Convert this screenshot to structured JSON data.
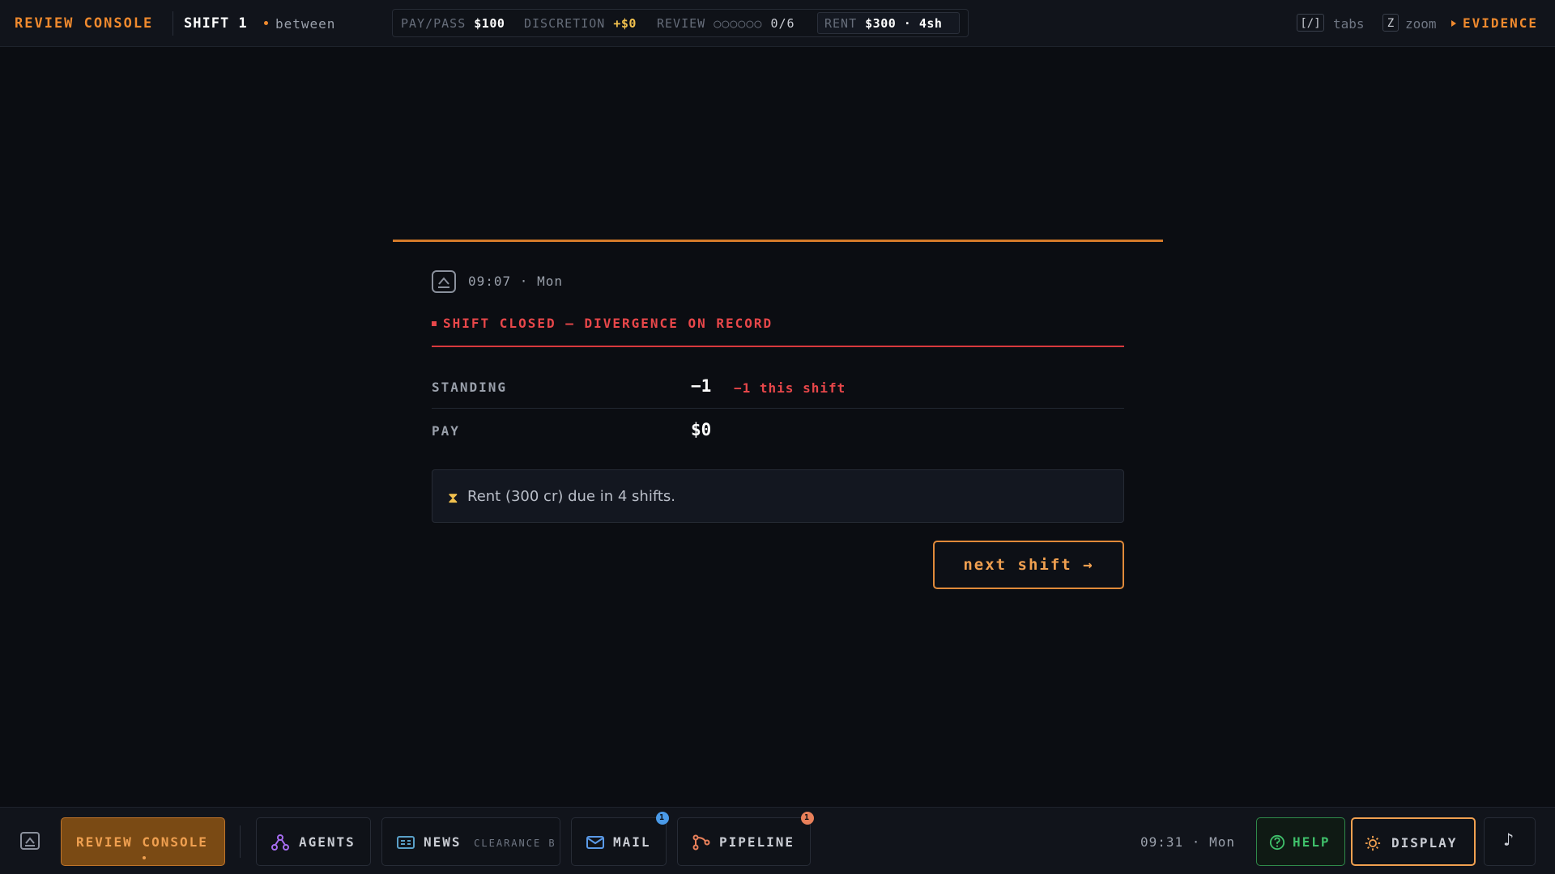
{
  "topbar": {
    "brand": "REVIEW CONSOLE",
    "shift": "SHIFT 1",
    "phase": "between",
    "pay_pass_label": "PAY/PASS",
    "pay_pass_value": "$100",
    "discretion_label": "DISCRETION",
    "discretion_value": "+$0",
    "review_label": "REVIEW",
    "review_dots": "○○○○○○",
    "review_value": "0/6",
    "rent_label": "RENT",
    "rent_value": "$300 · 4sh",
    "tabs_key": "[/]",
    "tabs_label": "tabs",
    "zoom_key": "Z",
    "zoom_label": "zoom",
    "evidence_label": "EVIDENCE"
  },
  "card": {
    "timestamp": "09:07 · Mon",
    "title": "SHIFT CLOSED — DIVERGENCE ON RECORD",
    "standing_label": "STANDING",
    "standing_value": "−1",
    "standing_delta": "−1 this shift",
    "pay_label": "PAY",
    "pay_value": "$0",
    "rent_note": "Rent (300 cr) due in 4 shifts.",
    "next_button": "next shift →"
  },
  "bottombar": {
    "tabs": [
      {
        "label": "REVIEW CONSOLE",
        "active": true
      },
      {
        "label": "AGENTS"
      },
      {
        "label": "NEWS",
        "sub": "CLEARANCE B"
      },
      {
        "label": "MAIL",
        "badge": "1"
      },
      {
        "label": "PIPELINE",
        "badge": "1"
      }
    ],
    "time": "09:31 · Mon",
    "help_label": "HELP",
    "display_label": "DISPLAY",
    "music_glyph": "♪"
  },
  "colors": {
    "accent": "#f08a2e",
    "alert": "#e8474a",
    "gold": "#f2c14e",
    "help_green": "#3fbf6a",
    "mail_badge": "#4a9ae8",
    "pipeline_badge": "#e8805a"
  }
}
